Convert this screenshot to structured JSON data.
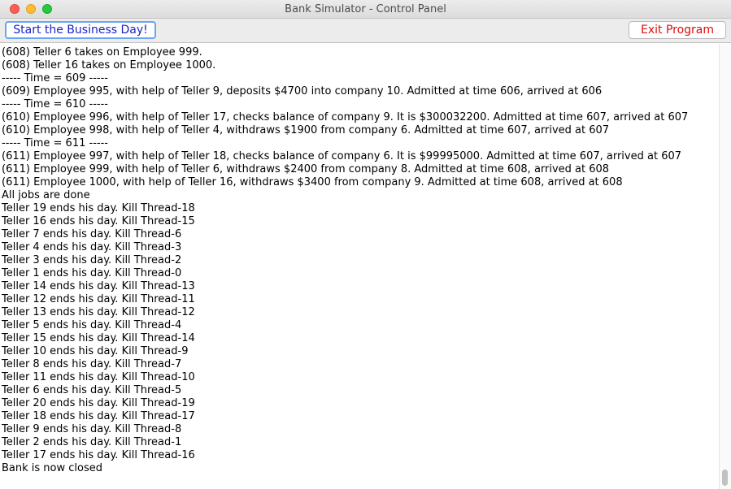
{
  "window": {
    "title": "Bank Simulator - Control Panel"
  },
  "toolbar": {
    "start_label": "Start the Business Day!",
    "exit_label": "Exit Program"
  },
  "log": {
    "lines": [
      "(608) Teller 6 takes on Employee 999.",
      "(608) Teller 16 takes on Employee 1000.",
      "----- Time = 609 -----",
      "(609) Employee 995, with help of Teller 9, deposits $4700 into company 10. Admitted at time 606, arrived at 606",
      "----- Time = 610 -----",
      "(610) Employee 996, with help of Teller 17, checks balance of company 9. It is $300032200. Admitted at time 607, arrived at 607",
      "(610) Employee 998, with help of Teller 4, withdraws $1900 from company 6. Admitted at time 607, arrived at 607",
      "----- Time = 611 -----",
      "(611) Employee 997, with help of Teller 18, checks balance of company 6. It is $99995000. Admitted at time 607, arrived at 607",
      "(611) Employee 999, with help of Teller 6, withdraws $2400 from company 8. Admitted at time 608, arrived at 608",
      "(611) Employee 1000, with help of Teller 16, withdraws $3400 from company 9. Admitted at time 608, arrived at 608",
      "All jobs are done",
      "Teller 19 ends his day. Kill Thread-18",
      "Teller 16 ends his day. Kill Thread-15",
      "Teller 7 ends his day. Kill Thread-6",
      "Teller 4 ends his day. Kill Thread-3",
      "Teller 3 ends his day. Kill Thread-2",
      "Teller 1 ends his day. Kill Thread-0",
      "Teller 14 ends his day. Kill Thread-13",
      "Teller 12 ends his day. Kill Thread-11",
      "Teller 13 ends his day. Kill Thread-12",
      "Teller 5 ends his day. Kill Thread-4",
      "Teller 15 ends his day. Kill Thread-14",
      "Teller 10 ends his day. Kill Thread-9",
      "Teller 8 ends his day. Kill Thread-7",
      "Teller 11 ends his day. Kill Thread-10",
      "Teller 6 ends his day. Kill Thread-5",
      "Teller 20 ends his day. Kill Thread-19",
      "Teller 18 ends his day. Kill Thread-17",
      "Teller 9 ends his day. Kill Thread-8",
      "Teller 2 ends his day. Kill Thread-1",
      "Teller 17 ends his day. Kill Thread-16",
      "Bank is now closed"
    ]
  },
  "scroll": {
    "position": 1.0
  }
}
